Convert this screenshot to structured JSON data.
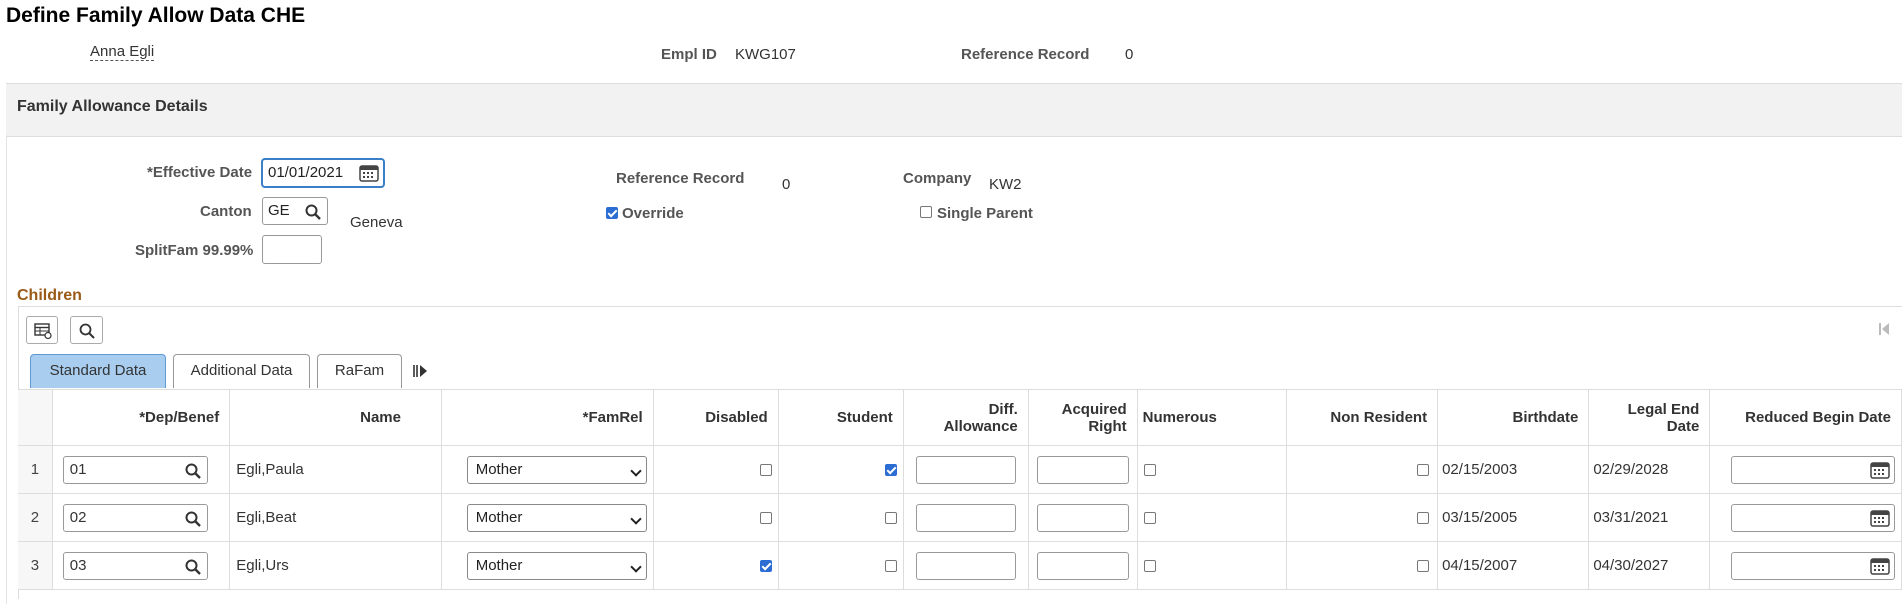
{
  "page": {
    "title": "Define Family Allow Data CHE"
  },
  "header": {
    "employee_name": "Anna Egli",
    "empl_id_label": "Empl ID",
    "empl_id_value": "KWG107",
    "ref_record_label": "Reference Record",
    "ref_record_value": "0"
  },
  "section": {
    "title": "Family Allowance Details",
    "effective_date_label": "*Effective Date",
    "effective_date_value": "01/01/2021",
    "canton_label": "Canton",
    "canton_value": "GE",
    "canton_desc": "Geneva",
    "splitfam_label": "SplitFam 99.99%",
    "splitfam_value": "",
    "ref_record_label": "Reference Record",
    "ref_record_value": "0",
    "company_label": "Company",
    "company_value": "KW2",
    "override_label": "Override",
    "override_checked": true,
    "single_parent_label": "Single Parent",
    "single_parent_checked": false
  },
  "children": {
    "title": "Children",
    "tabs": [
      {
        "label": "Standard Data",
        "active": true
      },
      {
        "label": "Additional Data",
        "active": false
      },
      {
        "label": "RaFam",
        "active": false
      }
    ],
    "columns": [
      "*Dep/Benef",
      "Name",
      "*FamRel",
      "Disabled",
      "Student",
      "Diff. Allowance",
      "Acquired Right",
      "Numerous",
      "Non Resident",
      "Birthdate",
      "Legal End Date",
      "Reduced Begin Date"
    ],
    "rows": [
      {
        "num": "1",
        "dep": "01",
        "name": "Egli,Paula",
        "famrel": "Mother",
        "disabled": false,
        "student": true,
        "numerous": false,
        "nonres": false,
        "birthdate": "02/15/2003",
        "legal_end": "02/29/2028"
      },
      {
        "num": "2",
        "dep": "02",
        "name": "Egli,Beat",
        "famrel": "Mother",
        "disabled": false,
        "student": false,
        "numerous": false,
        "nonres": false,
        "birthdate": "03/15/2005",
        "legal_end": "03/31/2021"
      },
      {
        "num": "3",
        "dep": "03",
        "name": "Egli,Urs",
        "famrel": "Mother",
        "disabled": true,
        "student": false,
        "numerous": false,
        "nonres": false,
        "birthdate": "04/15/2007",
        "legal_end": "04/30/2027"
      }
    ]
  },
  "icons": {
    "calendar": "calendar-icon",
    "search": "search-icon",
    "grid_settings": "grid-settings-icon",
    "show_all_columns": "show-all-columns-icon",
    "first_page": "first-page-icon"
  },
  "colors": {
    "accent": "#3a7fc8",
    "active_tab": "#a8cdef",
    "children_title": "#9a5a18",
    "checkbox_on": "#2c6dd3"
  }
}
